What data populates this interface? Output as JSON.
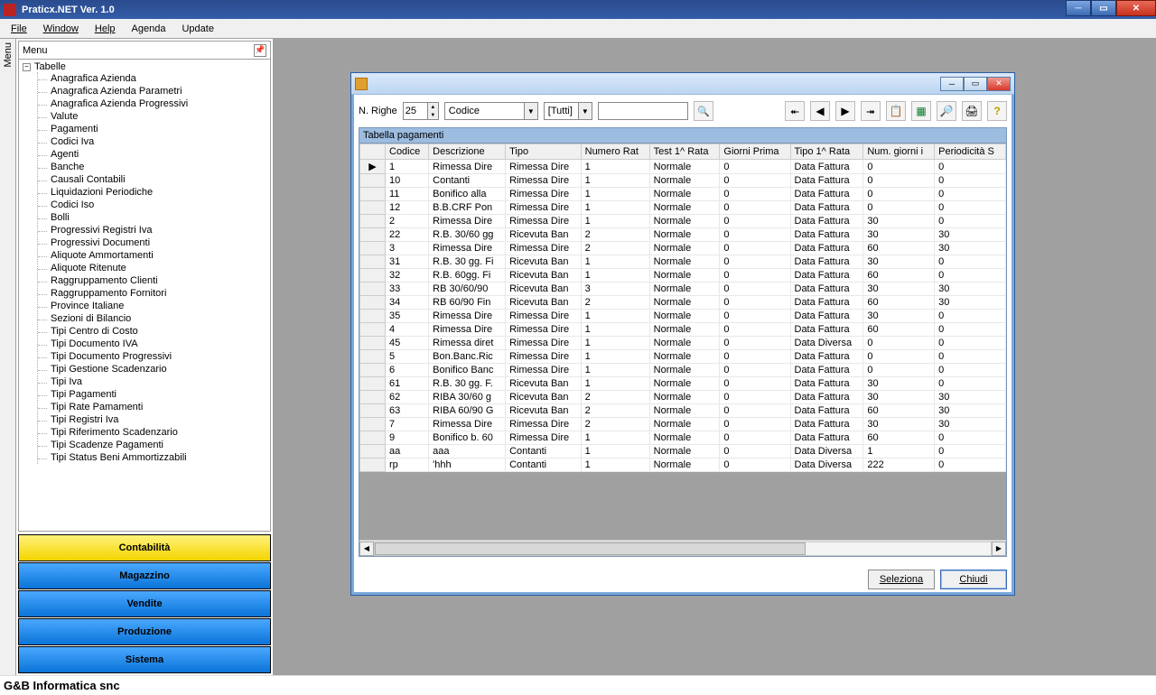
{
  "window": {
    "title": "Praticx.NET Ver. 1.0"
  },
  "menubar": [
    "File",
    "Window",
    "Help",
    "Agenda",
    "Update"
  ],
  "sidepanel": {
    "header": "Menu",
    "vtab": "Menu",
    "root": "Tabelle",
    "items": [
      "Anagrafica Azienda",
      "Anagrafica Azienda Parametri",
      "Anagrafica Azienda Progressivi",
      "Valute",
      "Pagamenti",
      "Codici Iva",
      "Agenti",
      "Banche",
      "Causali Contabili",
      "Liquidazioni Periodiche",
      "Codici Iso",
      "Bolli",
      "Progressivi Registri Iva",
      "Progressivi Documenti",
      "Aliquote Ammortamenti",
      "Aliquote Ritenute",
      "Raggruppamento Clienti",
      "Raggruppamento Fornitori",
      "Province Italiane",
      "Sezioni di Bilancio",
      "Tipi Centro di Costo",
      "Tipi Documento IVA",
      "Tipi Documento Progressivi",
      "Tipi Gestione Scadenzario",
      "Tipi Iva",
      "Tipi Pagamenti",
      "Tipi Rate Pamamenti",
      "Tipi Registri Iva",
      "Tipi Riferimento Scadenzario",
      "Tipi Scadenze Pagamenti",
      "Tipi Status Beni Ammortizzabili"
    ],
    "nav": [
      "Contabilità",
      "Magazzino",
      "Vendite",
      "Produzione",
      "Sistema"
    ]
  },
  "dialog": {
    "toolbar": {
      "nrighe_label": "N. Righe",
      "nrighe_value": "25",
      "field_combo": "Codice",
      "filter_combo": "[Tutti]",
      "search_value": ""
    },
    "grid": {
      "caption": "Tabella pagamenti",
      "columns": [
        "",
        "Codice",
        "Descrizione",
        "Tipo",
        "Numero Rat",
        "Test 1^ Rata",
        "Giorni Prima",
        "Tipo 1^ Rata",
        "Num. giorni i",
        "Periodicità S"
      ],
      "rows": [
        {
          "sel": "▶",
          "c": [
            "1",
            "Rimessa Dire",
            "Rimessa Dire",
            "1",
            "Normale",
            "0",
            "Data Fattura",
            "0",
            "0"
          ]
        },
        {
          "sel": "",
          "c": [
            "10",
            "Contanti",
            "Rimessa Dire",
            "1",
            "Normale",
            "0",
            "Data Fattura",
            "0",
            "0"
          ]
        },
        {
          "sel": "",
          "c": [
            "11",
            "Bonifico alla",
            "Rimessa Dire",
            "1",
            "Normale",
            "0",
            "Data Fattura",
            "0",
            "0"
          ]
        },
        {
          "sel": "",
          "c": [
            "12",
            "B.B.CRF Pon",
            "Rimessa Dire",
            "1",
            "Normale",
            "0",
            "Data Fattura",
            "0",
            "0"
          ]
        },
        {
          "sel": "",
          "c": [
            "2",
            "Rimessa Dire",
            "Rimessa Dire",
            "1",
            "Normale",
            "0",
            "Data Fattura",
            "30",
            "0"
          ]
        },
        {
          "sel": "",
          "c": [
            "22",
            "R.B. 30/60 gg",
            "Ricevuta Ban",
            "2",
            "Normale",
            "0",
            "Data Fattura",
            "30",
            "30"
          ]
        },
        {
          "sel": "",
          "c": [
            "3",
            "Rimessa Dire",
            "Rimessa Dire",
            "2",
            "Normale",
            "0",
            "Data Fattura",
            "60",
            "30"
          ]
        },
        {
          "sel": "",
          "c": [
            "31",
            "R.B. 30 gg. Fi",
            "Ricevuta Ban",
            "1",
            "Normale",
            "0",
            "Data Fattura",
            "30",
            "0"
          ]
        },
        {
          "sel": "",
          "c": [
            "32",
            "R.B. 60gg. Fi",
            "Ricevuta Ban",
            "1",
            "Normale",
            "0",
            "Data Fattura",
            "60",
            "0"
          ]
        },
        {
          "sel": "",
          "c": [
            "33",
            "RB 30/60/90",
            "Ricevuta Ban",
            "3",
            "Normale",
            "0",
            "Data Fattura",
            "30",
            "30"
          ]
        },
        {
          "sel": "",
          "c": [
            "34",
            "RB 60/90 Fin",
            "Ricevuta Ban",
            "2",
            "Normale",
            "0",
            "Data Fattura",
            "60",
            "30"
          ]
        },
        {
          "sel": "",
          "c": [
            "35",
            "Rimessa Dire",
            "Rimessa Dire",
            "1",
            "Normale",
            "0",
            "Data Fattura",
            "30",
            "0"
          ]
        },
        {
          "sel": "",
          "c": [
            "4",
            "Rimessa Dire",
            "Rimessa Dire",
            "1",
            "Normale",
            "0",
            "Data Fattura",
            "60",
            "0"
          ]
        },
        {
          "sel": "",
          "c": [
            "45",
            "Rimessa diret",
            "Rimessa Dire",
            "1",
            "Normale",
            "0",
            "Data Diversa",
            "0",
            "0"
          ]
        },
        {
          "sel": "",
          "c": [
            "5",
            "Bon.Banc.Ric",
            "Rimessa Dire",
            "1",
            "Normale",
            "0",
            "Data Fattura",
            "0",
            "0"
          ]
        },
        {
          "sel": "",
          "c": [
            "6",
            "Bonifico Banc",
            "Rimessa Dire",
            "1",
            "Normale",
            "0",
            "Data Fattura",
            "0",
            "0"
          ]
        },
        {
          "sel": "",
          "c": [
            "61",
            "R.B. 30 gg. F.",
            "Ricevuta Ban",
            "1",
            "Normale",
            "0",
            "Data Fattura",
            "30",
            "0"
          ]
        },
        {
          "sel": "",
          "c": [
            "62",
            "RIBA 30/60 g",
            "Ricevuta Ban",
            "2",
            "Normale",
            "0",
            "Data Fattura",
            "30",
            "30"
          ]
        },
        {
          "sel": "",
          "c": [
            "63",
            "RIBA 60/90 G",
            "Ricevuta Ban",
            "2",
            "Normale",
            "0",
            "Data Fattura",
            "60",
            "30"
          ]
        },
        {
          "sel": "",
          "c": [
            "7",
            "Rimessa Dire",
            "Rimessa Dire",
            "2",
            "Normale",
            "0",
            "Data Fattura",
            "30",
            "30"
          ]
        },
        {
          "sel": "",
          "c": [
            "9",
            "Bonifico b. 60",
            "Rimessa Dire",
            "1",
            "Normale",
            "0",
            "Data Fattura",
            "60",
            "0"
          ]
        },
        {
          "sel": "",
          "c": [
            "aa",
            "aaa",
            "Contanti",
            "1",
            "Normale",
            "0",
            "Data Diversa",
            "1",
            "0"
          ]
        },
        {
          "sel": "",
          "c": [
            "rp",
            "'hhh",
            "Contanti",
            "1",
            "Normale",
            "0",
            "Data Diversa",
            "222",
            "0"
          ]
        }
      ]
    },
    "buttons": {
      "select": "Seleziona",
      "close": "Chiudi"
    }
  },
  "footer": "G&B Informatica snc"
}
